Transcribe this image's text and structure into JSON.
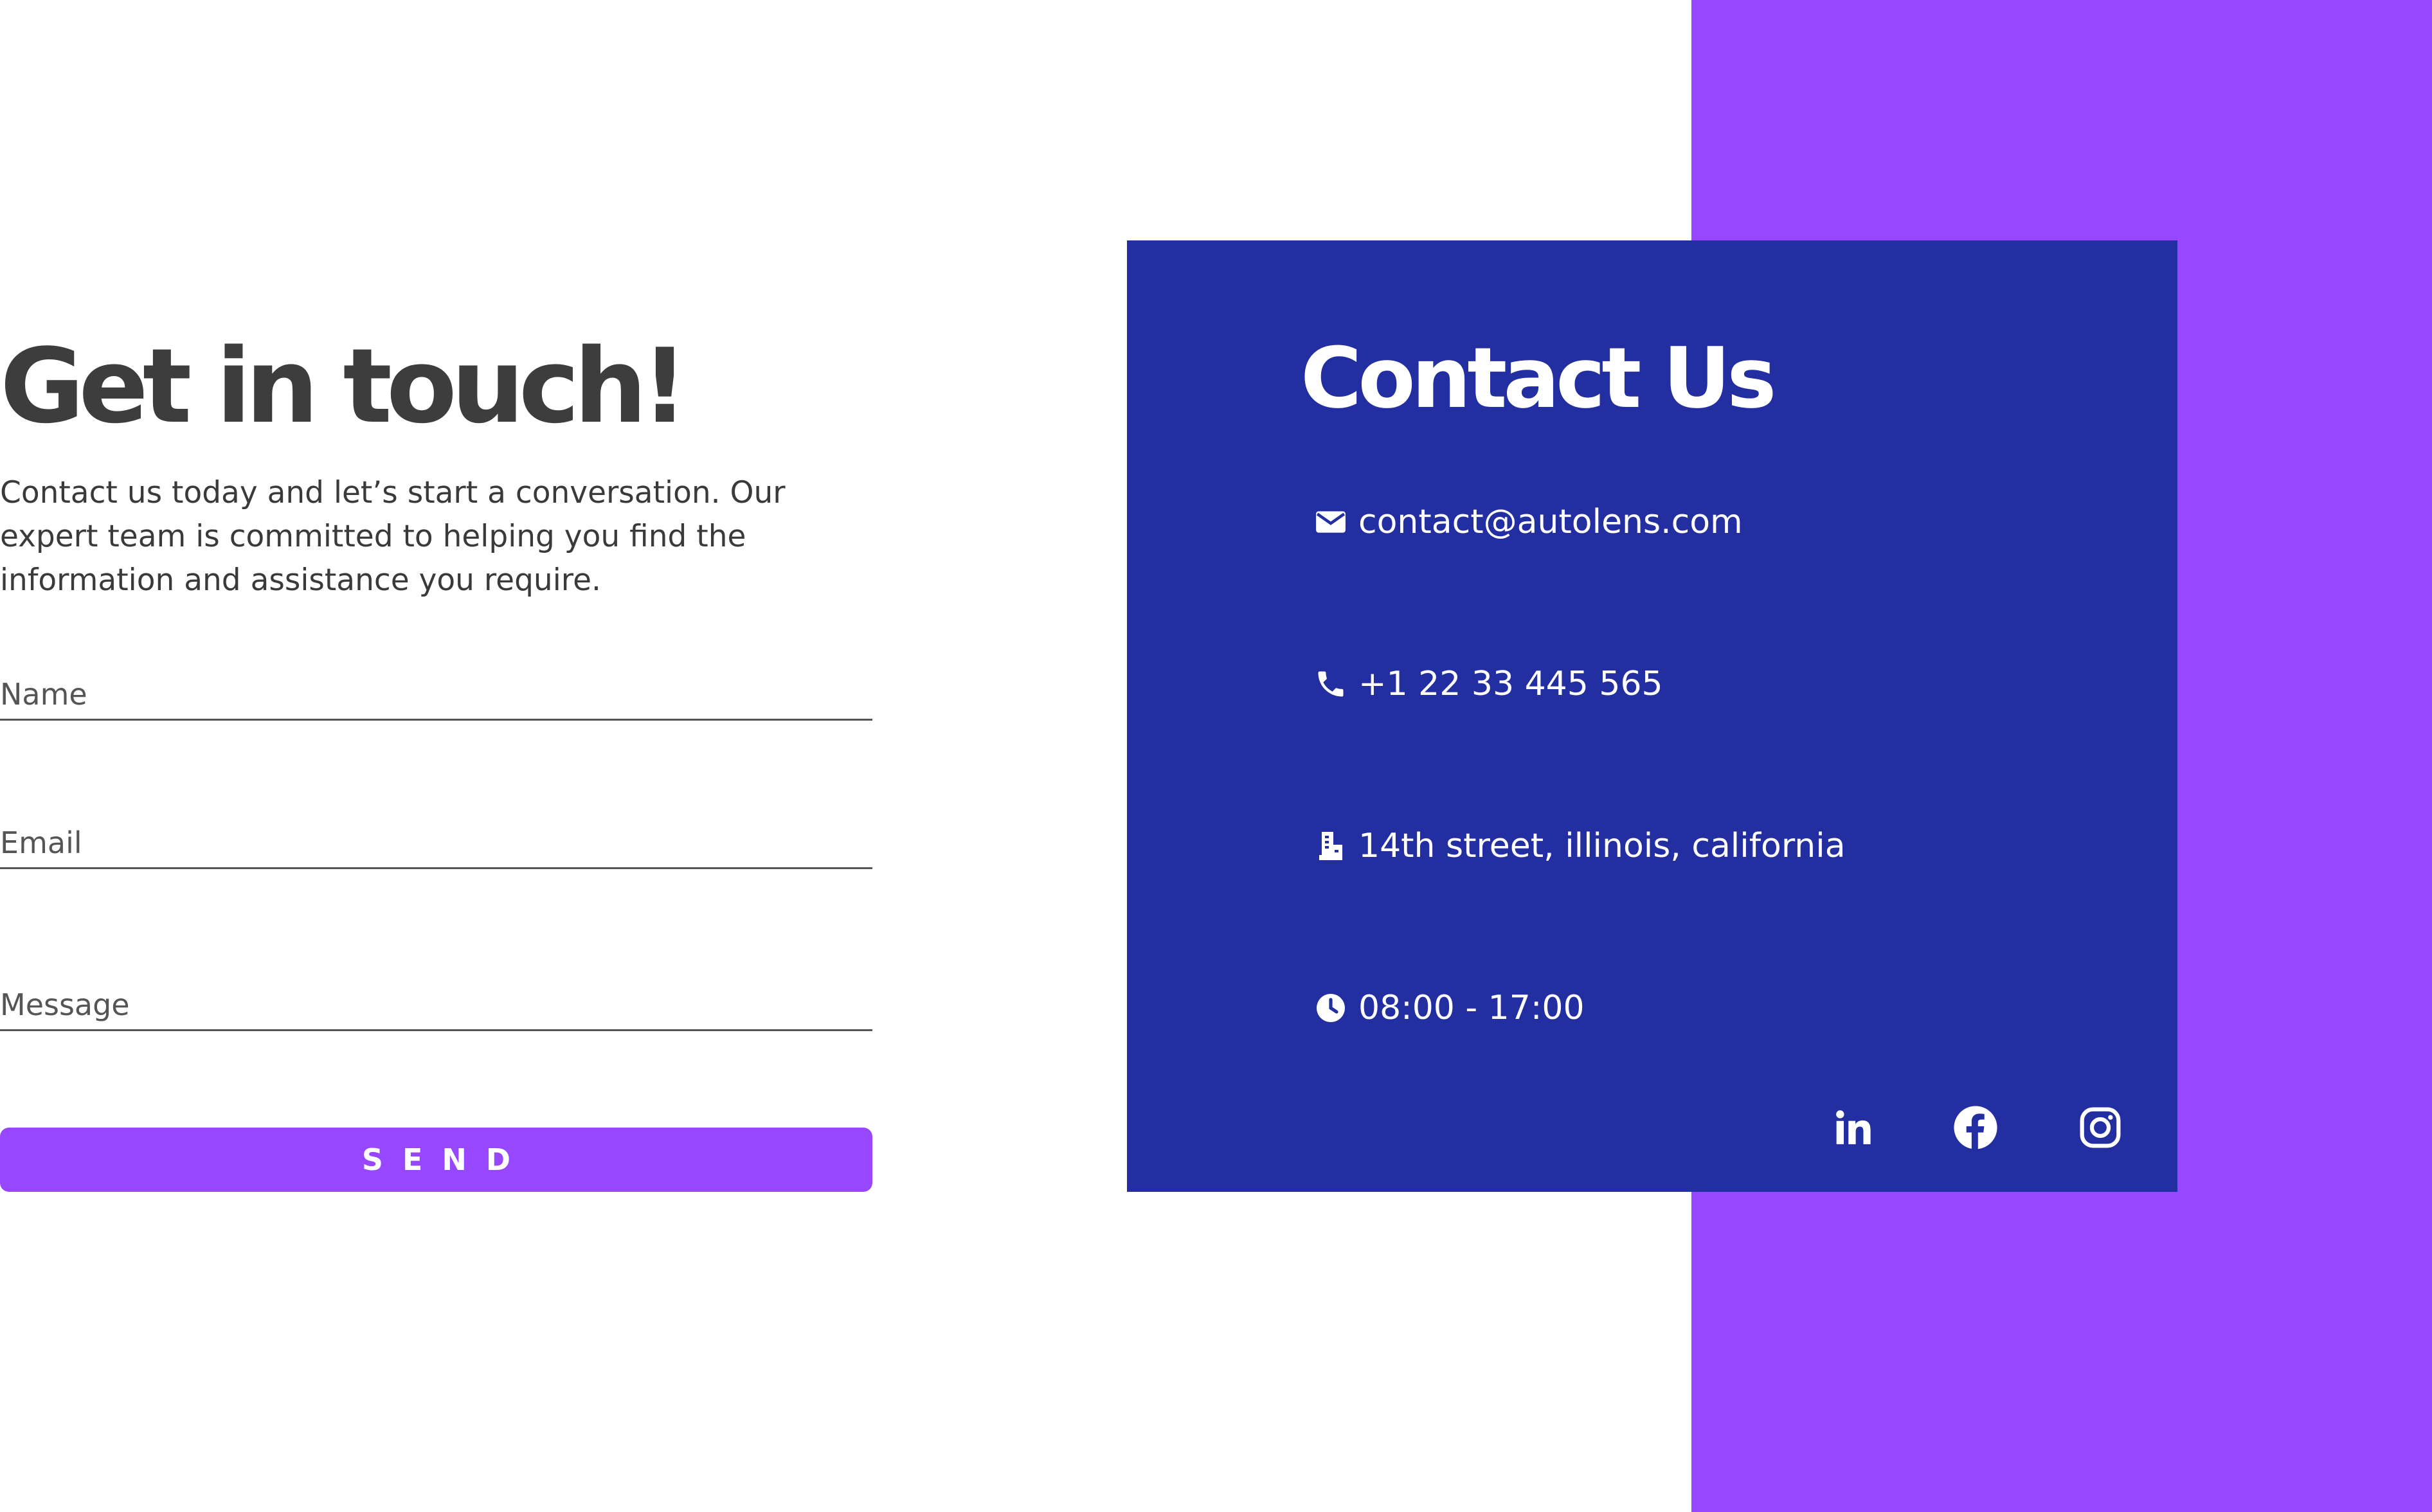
{
  "colors": {
    "accent_purple": "#9747ff",
    "card_blue": "#232ea1",
    "heading_text": "#3d3d3d",
    "white": "#ffffff"
  },
  "form": {
    "heading": "Get in touch!",
    "intro": "Contact us today and let’s start a conversation. Our expert team is committed to helping you find the information and assistance you require.",
    "name_placeholder": "Name",
    "email_placeholder": "Email",
    "message_placeholder": "Message",
    "send_label": "SEND"
  },
  "contact": {
    "title": "Contact Us",
    "email": "contact@autolens.com",
    "phone": "+1 22 33 445 565",
    "address": "14th street, illinois, california",
    "hours": "08:00 - 17:00",
    "icons": [
      "envelope-icon",
      "phone-icon",
      "building-icon",
      "clock-icon"
    ]
  },
  "social": {
    "icons": [
      "linkedin-icon",
      "facebook-icon",
      "instagram-icon"
    ]
  }
}
